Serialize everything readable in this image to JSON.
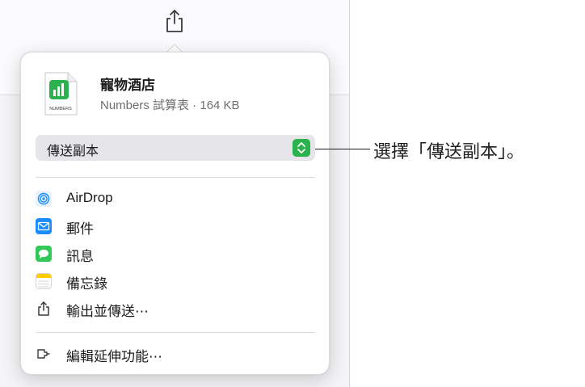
{
  "file": {
    "name": "寵物酒店",
    "meta": "Numbers 試算表 · 164 KB",
    "icon_caption": "NUMBERS"
  },
  "send_select": {
    "value": "傳送副本"
  },
  "menu": {
    "items": [
      {
        "label": "AirDrop",
        "icon": "airdrop-icon"
      },
      {
        "label": "郵件",
        "icon": "mail-icon"
      },
      {
        "label": "訊息",
        "icon": "messages-icon"
      },
      {
        "label": "備忘錄",
        "icon": "notes-icon"
      },
      {
        "label": "輸出並傳送⋯",
        "icon": "export-share-icon"
      }
    ],
    "extensions_label": "編輯延伸功能⋯"
  },
  "callout": {
    "text": "選擇「傳送副本」。"
  },
  "colors": {
    "accent_green": "#2bb24c",
    "mail_blue": "#1a8cff"
  }
}
